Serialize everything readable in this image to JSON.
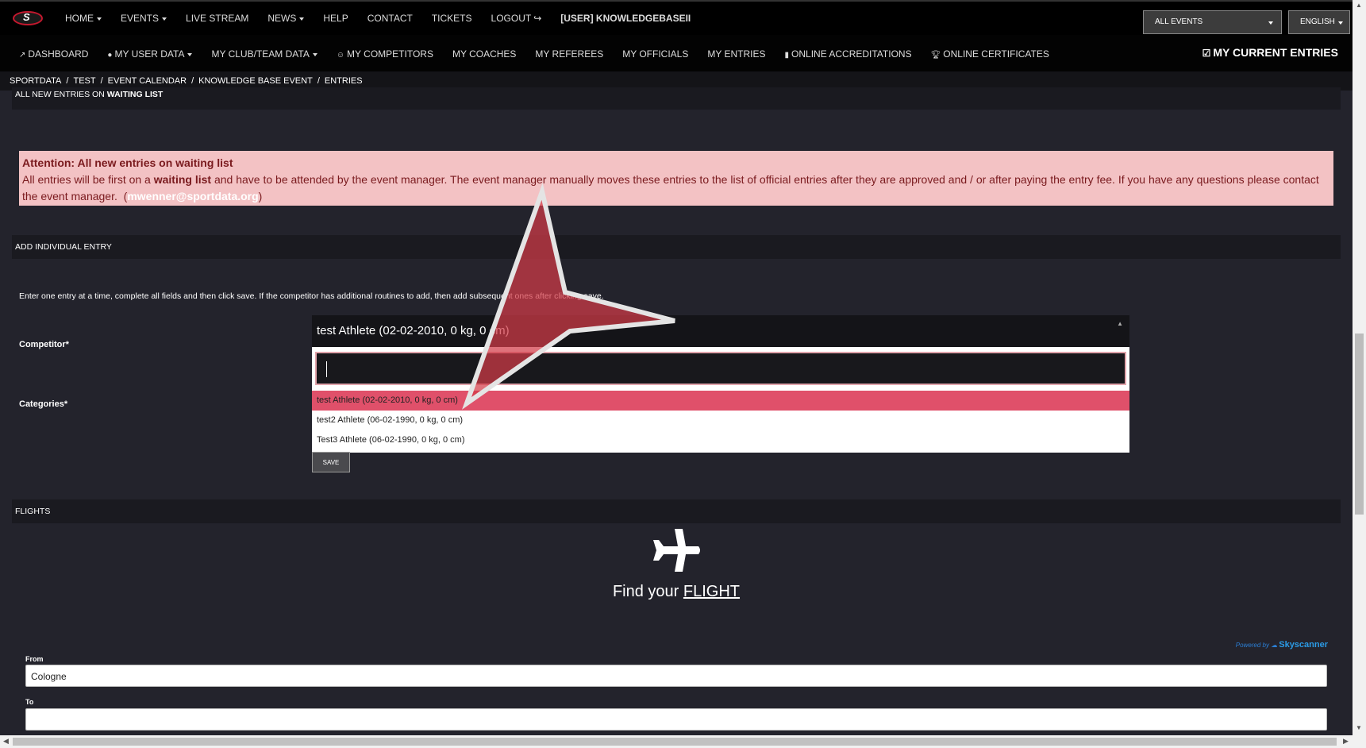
{
  "topnav": {
    "logo_letter": "S",
    "items": [
      {
        "label": "HOME",
        "dropdown": true
      },
      {
        "label": "EVENTS",
        "dropdown": true
      },
      {
        "label": "LIVE STREAM"
      },
      {
        "label": "NEWS",
        "dropdown": true
      },
      {
        "label": "HELP"
      },
      {
        "label": "CONTACT"
      },
      {
        "label": "TICKETS"
      },
      {
        "label": "LOGOUT"
      },
      {
        "label": "[USER] KNOWLEDGEBASEII"
      }
    ],
    "all_events": "ALL EVENTS",
    "language": "ENGLISH"
  },
  "subnav": {
    "items": [
      "DASHBOARD",
      "MY USER DATA",
      "MY CLUB/TEAM DATA",
      "MY COMPETITORS",
      "MY COACHES",
      "MY REFEREES",
      "MY OFFICIALS",
      "MY ENTRIES",
      "ONLINE ACCREDITATIONS",
      "ONLINE CERTIFICATES"
    ],
    "current_entries": "MY CURRENT ENTRIES"
  },
  "breadcrumb": [
    "SPORTDATA",
    "TEST",
    "EVENT CALENDAR",
    "KNOWLEDGE BASE EVENT",
    "ENTRIES"
  ],
  "waiting": {
    "heading_prefix": "ALL NEW ENTRIES ON",
    "heading_bold": "WAITING LIST"
  },
  "alert": {
    "title": "Attention: All new entries on waiting list",
    "text_1": "All entries will be first on a",
    "text_bold": "waiting list",
    "text_2": "and have to be attended by the event manager. The event manager manually moves these entries to the list of official entries after they are approved and / or after paying the entry fee. If you have any questions please contact the event manager.",
    "open_paren": "(",
    "email": "mwenner@sportdata.org",
    "close_paren": ")"
  },
  "individual_entry": {
    "heading": "ADD INDIVIDUAL ENTRY",
    "instruction": "Enter one entry at a time, complete all fields and then click save. If the competitor has additional routines to add, then add subsequent ones after clicking save.",
    "competitor_label": "Competitor*",
    "categories_label": "Categories*",
    "selected_competitor": "test Athlete (02-02-2010, 0 kg, 0 cm)",
    "search_value": "",
    "options": [
      "test Athlete (02-02-2010, 0 kg, 0 cm)",
      "test2 Athlete (06-02-1990, 0 kg, 0 cm)",
      "Test3 Athlete (06-02-1990, 0 kg, 0 cm)"
    ],
    "save_label": "SAVE"
  },
  "flights": {
    "heading": "FLIGHTS",
    "find_prefix": "Find your",
    "find_link": "FLIGHT",
    "powered_by": "Powered by",
    "provider": "Skyscanner",
    "from_label": "From",
    "from_value": "Cologne",
    "to_label": "To",
    "to_value": ""
  },
  "colors": {
    "alert_bg": "#f3c2c4",
    "alert_text": "#7a1a1e",
    "selected_option": "#e0506a",
    "page_bg": "#23232c"
  }
}
